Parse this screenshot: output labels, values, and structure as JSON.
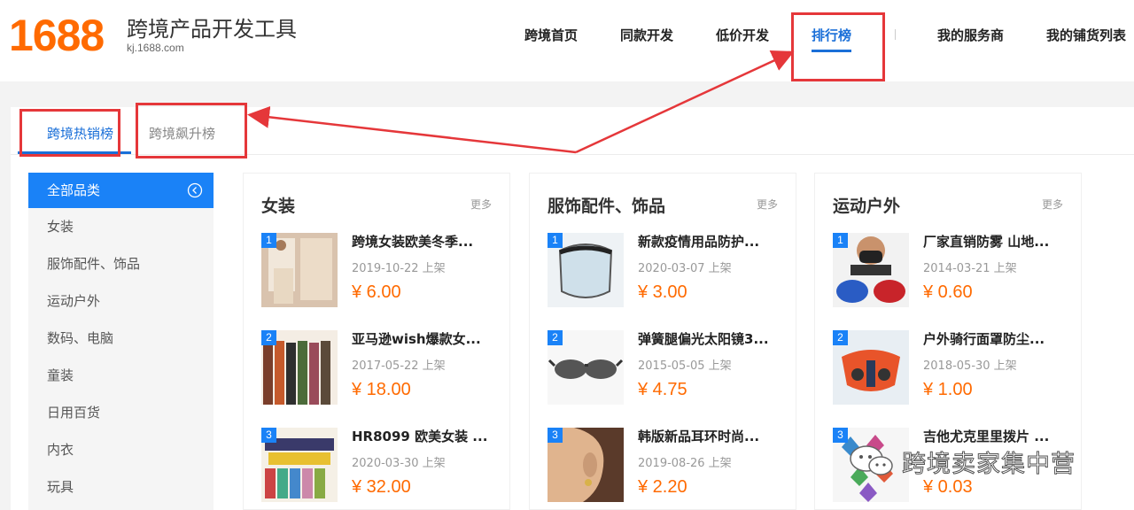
{
  "header": {
    "logo": "1688",
    "title": "跨境产品开发工具",
    "subtitle": "kj.1688.com",
    "nav": [
      "跨境首页",
      "同款开发",
      "低价开发",
      "排行榜",
      "我的服务商",
      "我的铺货列表"
    ],
    "active_nav": "排行榜"
  },
  "tabs": [
    "跨境热销榜",
    "跨境飙升榜"
  ],
  "active_tab": "跨境热销榜",
  "sidebar": {
    "items": [
      "全部品类",
      "女装",
      "服饰配件、饰品",
      "运动户外",
      "数码、电脑",
      "童装",
      "日用百货",
      "内衣",
      "玩具"
    ],
    "active": "全部品类"
  },
  "columns": [
    {
      "title": "女装",
      "more": "更多",
      "items": [
        {
          "rank": "1",
          "name": "跨境女装欧美冬季...",
          "date": "2019-10-22 上架",
          "price": "¥ 6.00"
        },
        {
          "rank": "2",
          "name": "亚马逊wish爆款女...",
          "date": "2017-05-22 上架",
          "price": "¥ 18.00"
        },
        {
          "rank": "3",
          "name": "HR8099 欧美女装 ...",
          "date": "2020-03-30 上架",
          "price": "¥ 32.00"
        }
      ]
    },
    {
      "title": "服饰配件、饰品",
      "more": "更多",
      "items": [
        {
          "rank": "1",
          "name": "新款疫情用品防护...",
          "date": "2020-03-07 上架",
          "price": "¥ 3.00"
        },
        {
          "rank": "2",
          "name": "弹簧腿偏光太阳镜3...",
          "date": "2015-05-05 上架",
          "price": "¥ 4.75"
        },
        {
          "rank": "3",
          "name": "韩版新品耳环时尚...",
          "date": "2019-08-26 上架",
          "price": "¥ 2.20"
        }
      ]
    },
    {
      "title": "运动户外",
      "more": "更多",
      "items": [
        {
          "rank": "1",
          "name": "厂家直销防雾 山地...",
          "date": "2014-03-21 上架",
          "price": "¥ 0.60"
        },
        {
          "rank": "2",
          "name": "户外骑行面罩防尘...",
          "date": "2018-05-30 上架",
          "price": "¥ 1.00"
        },
        {
          "rank": "3",
          "name": "吉他尤克里里拨片 ...",
          "date": "",
          "price": "¥ 0.03"
        }
      ]
    }
  ],
  "watermark": "跨境卖家集中营",
  "colors": {
    "brand": "#ff6a00",
    "accent": "#1a82f7",
    "annotation": "#e5373a"
  }
}
